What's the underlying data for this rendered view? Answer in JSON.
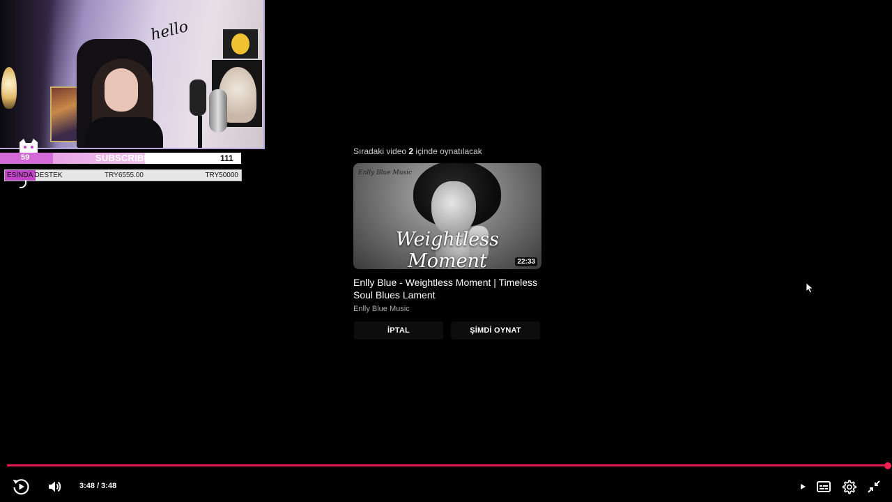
{
  "overlay": {
    "webcam_scene_text": "hello",
    "subscriber_goal": {
      "current": "59",
      "label": "SUBSCRIBERS",
      "target": "111"
    },
    "donation_goal": {
      "label": "ESİNDA DESTEK",
      "current": "TRY6555.00",
      "target": "TRY50000"
    }
  },
  "up_next": {
    "header_prefix": "Sıradaki video ",
    "countdown": "2",
    "header_suffix": " içinde oynatılacak",
    "thumbnail": {
      "brand_text": "Enlly Blue Music",
      "art_title": "Weightless Moment",
      "duration": "22:33"
    },
    "title": "Enlly Blue - Weightless Moment | Timeless Soul Blues Lament",
    "channel": "Enlly Blue Music",
    "cancel_label": "İPTAL",
    "play_now_label": "ŞİMDİ OYNAT"
  },
  "player": {
    "progress_fraction": 1.0,
    "time_display": "3:48 / 3:48",
    "accent_color": "#e01a4f",
    "icons": [
      "replay-icon",
      "volume-icon",
      "autoplay-icon",
      "subtitles-icon",
      "settings-icon",
      "exit-fullscreen-icon"
    ]
  }
}
